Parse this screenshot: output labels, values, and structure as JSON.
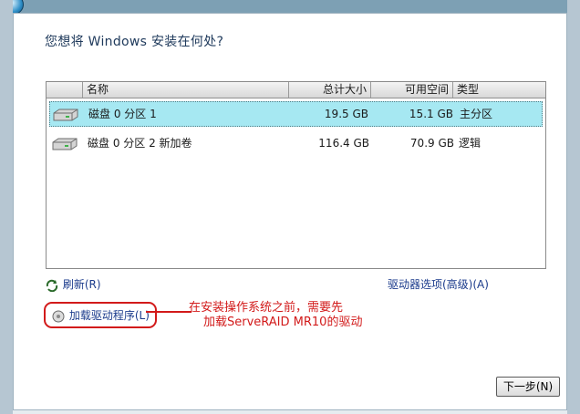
{
  "dialog": {
    "title": "您想将 Windows 安装在何处?"
  },
  "partitions": {
    "columns": {
      "name": "名称",
      "total": "总计大小",
      "free": "可用空间",
      "type": "类型"
    },
    "rows": [
      {
        "name": "磁盘 0 分区 1",
        "total": "19.5 GB",
        "free": "15.1 GB",
        "type": "主分区",
        "selected": true
      },
      {
        "name": "磁盘 0 分区 2 新加卷",
        "total": "116.4 GB",
        "free": "70.9 GB",
        "type": "逻辑",
        "selected": false
      }
    ]
  },
  "links": {
    "refresh": "刷新(R)",
    "drive_options": "驱动器选项(高级)(A)",
    "load_driver": "加载驱动程序(L)"
  },
  "annotation": {
    "line1": "在安装操作系统之前，需要先",
    "line2": "加载ServeRAID MR10的驱动"
  },
  "buttons": {
    "next": "下一步(N)"
  },
  "colors": {
    "selected_row": "#a6e8f2",
    "annotation": "#d21a1a",
    "link": "#1b3b8c"
  },
  "icons": [
    "windows-logo-icon",
    "disk-icon",
    "refresh-icon",
    "load-driver-icon"
  ]
}
